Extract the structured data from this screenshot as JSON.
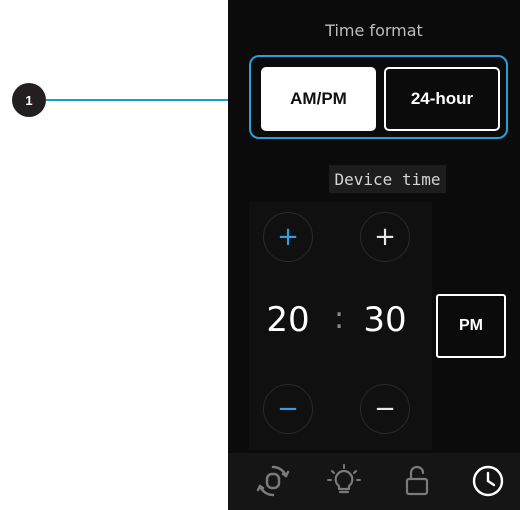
{
  "callout": {
    "number": "1",
    "line_color": "#1e9bd7"
  },
  "screen": {
    "time_format": {
      "title": "Time format",
      "options": [
        {
          "label": "AM/PM",
          "selected": true
        },
        {
          "label": "24-hour",
          "selected": false
        }
      ],
      "highlight_color": "#2a9fd8"
    },
    "device_time": {
      "label": "Device time",
      "hour": "20",
      "separator": ":",
      "minute": "30",
      "period": "PM",
      "increment_symbol": "+",
      "decrement_symbol": "−",
      "hour_stepper_color": "#2e9fe0"
    },
    "bottom_nav": {
      "items": [
        {
          "icon": "watch-sync-icon",
          "active": false
        },
        {
          "icon": "lightbulb-icon",
          "active": false
        },
        {
          "icon": "unlock-icon",
          "active": false
        },
        {
          "icon": "clock-icon",
          "active": true
        }
      ]
    }
  }
}
